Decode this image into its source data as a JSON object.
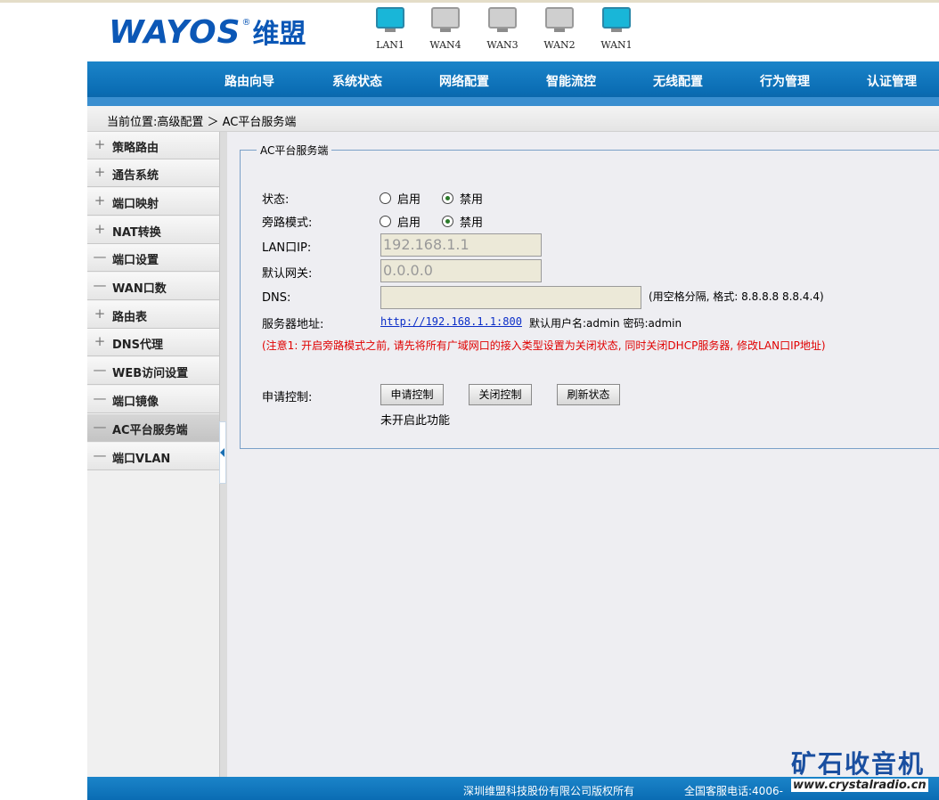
{
  "brand": {
    "name_en": "WAYOS",
    "reg": "®",
    "name_cn": "维盟"
  },
  "ports": [
    {
      "label": "LAN1",
      "active": true
    },
    {
      "label": "WAN4",
      "active": false
    },
    {
      "label": "WAN3",
      "active": false
    },
    {
      "label": "WAN2",
      "active": false
    },
    {
      "label": "WAN1",
      "active": true
    }
  ],
  "nav": [
    "路由向导",
    "系统状态",
    "网络配置",
    "智能流控",
    "无线配置",
    "行为管理",
    "认证管理"
  ],
  "breadcrumb": "当前位置:高级配置 ＞ AC平台服务端",
  "sidebar": [
    {
      "sign": "+",
      "label": "策略路由"
    },
    {
      "sign": "+",
      "label": "通告系统"
    },
    {
      "sign": "+",
      "label": "端口映射"
    },
    {
      "sign": "+",
      "label": "NAT转换"
    },
    {
      "sign": "—",
      "label": "端口设置"
    },
    {
      "sign": "—",
      "label": "WAN口数"
    },
    {
      "sign": "+",
      "label": "路由表"
    },
    {
      "sign": "+",
      "label": "DNS代理"
    },
    {
      "sign": "—",
      "label": "WEB访问设置"
    },
    {
      "sign": "—",
      "label": "端口镜像"
    },
    {
      "sign": "—",
      "label": "AC平台服务端",
      "active": true
    },
    {
      "sign": "—",
      "label": "端口VLAN"
    }
  ],
  "panel": {
    "legend": "AC平台服务端",
    "status_label": "状态:",
    "bypass_label": "旁路模式:",
    "enable": "启用",
    "disable": "禁用",
    "status_value": "disable",
    "bypass_value": "disable",
    "lan_ip_label": "LAN口IP:",
    "lan_ip": "192.168.1.1",
    "gateway_label": "默认网关:",
    "gateway": "0.0.0.0",
    "dns_label": "DNS:",
    "dns": "",
    "dns_hint": "(用空格分隔, 格式: 8.8.8.8 8.8.4.4)",
    "server_label": "服务器地址:",
    "server_url": "http://192.168.1.1:800",
    "account": "默认用户名:admin 密码:admin",
    "warning": "(注意1: 开启旁路模式之前, 请先将所有广域网口的接入类型设置为关闭状态, 同时关闭DHCP服务器, 修改LAN口IP地址)",
    "apply_label": "申请控制:",
    "btn_apply": "申请控制",
    "btn_close": "关闭控制",
    "btn_refresh": "刷新状态",
    "state_text": "未开启此功能"
  },
  "footer": {
    "copyright": "深圳维盟科技股份有限公司版权所有",
    "phone": "全国客服电话:4006-"
  },
  "watermark": {
    "cn": "矿石收音机",
    "url": "www.crystalradio.cn"
  },
  "colors": {
    "nav_blue": "#0a6cb3",
    "brand_blue": "#0b57b6",
    "warning_red": "#e00000",
    "port_active": "#19b6d8"
  }
}
